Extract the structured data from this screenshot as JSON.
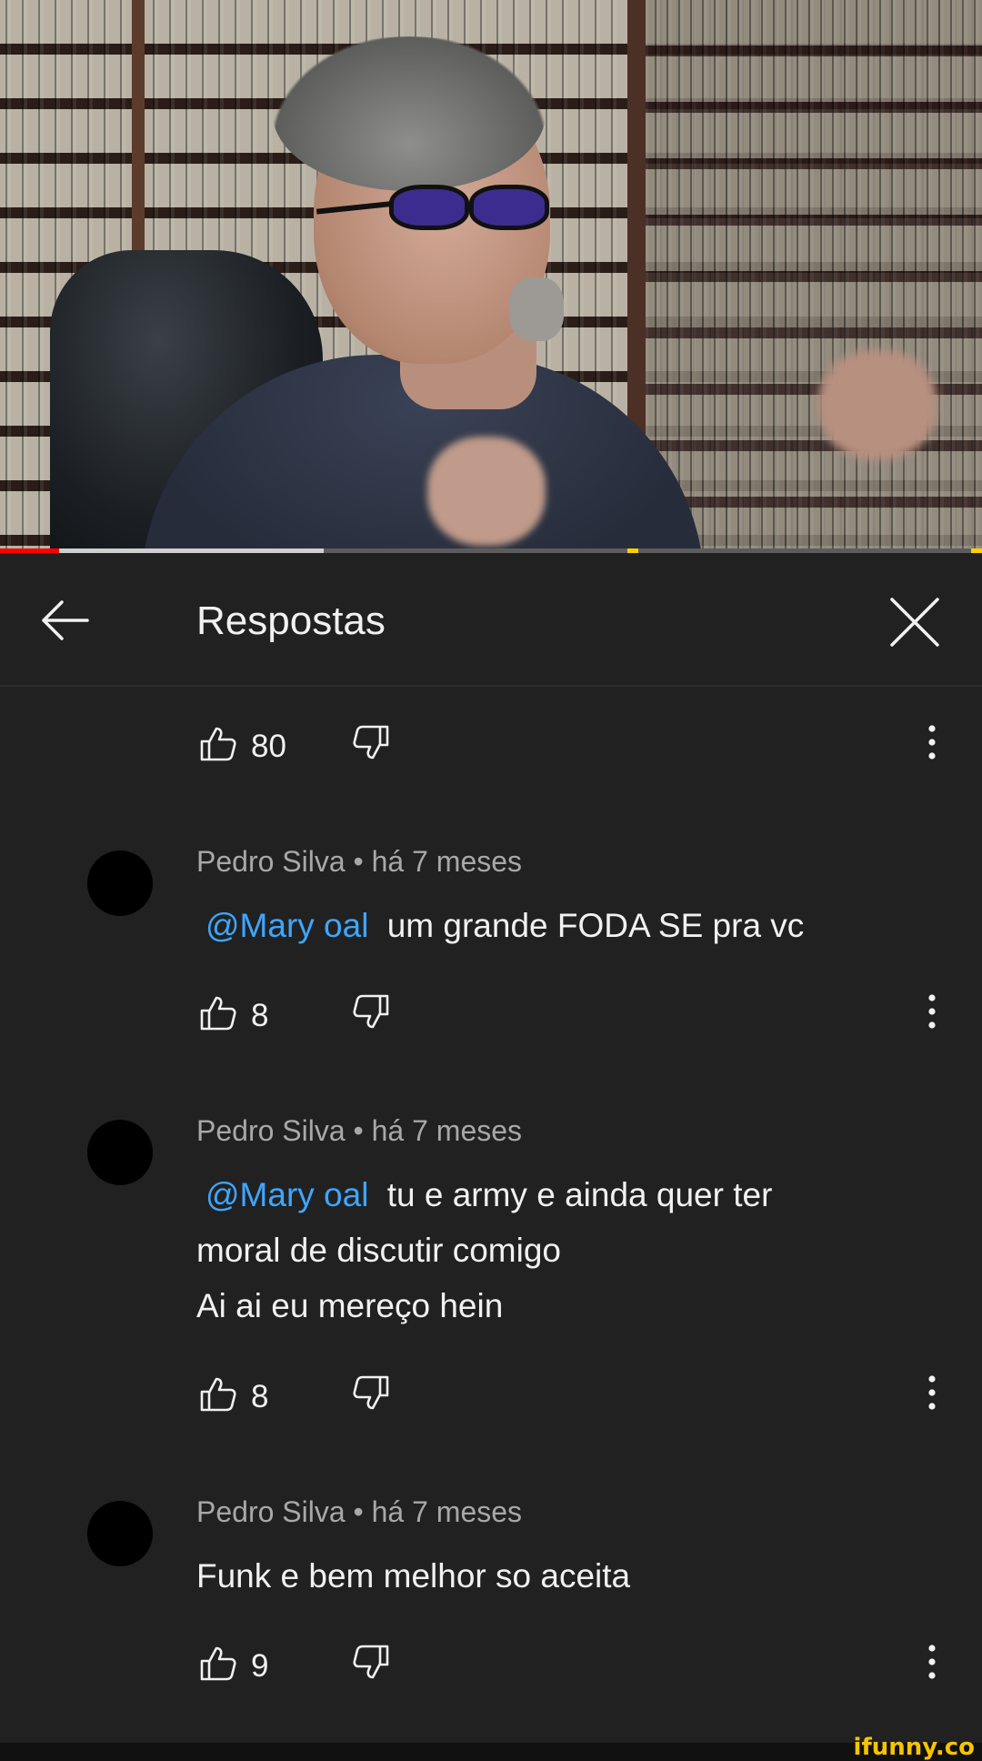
{
  "header": {
    "title": "Respostas"
  },
  "icons": {
    "back": "arrow-left-icon",
    "close": "close-icon",
    "like": "thumb-up-icon",
    "dislike": "thumb-down-icon",
    "more": "more-vert-icon"
  },
  "top_actions": {
    "likes": "80"
  },
  "comments": [
    {
      "author": "Pedro Silva",
      "time": "há 7 meses",
      "meta": "Pedro Silva • há 7 meses",
      "mention": "@Mary oal",
      "lines": [
        "um grande FODA SE pra vc"
      ],
      "likes": "8"
    },
    {
      "author": "Pedro Silva",
      "time": "há 7 meses",
      "meta": "Pedro Silva • há 7 meses",
      "mention": "@Mary oal",
      "lines": [
        "tu e army e ainda quer ter",
        "moral de discutir comigo",
        "Ai ai eu mereço hein"
      ],
      "likes": "8"
    },
    {
      "author": "Pedro Silva",
      "time": "há 7 meses",
      "meta": "Pedro Silva • há 7 meses",
      "mention": "",
      "lines": [
        "Funk e bem melhor so aceita"
      ],
      "likes": "9"
    }
  ],
  "video": {
    "progress_played": 0.06,
    "progress_buffered": 0.33
  },
  "colors": {
    "background": "#212121",
    "mention": "#3ea6ff",
    "progress": "#ff0000",
    "meta_text": "#a8a8a8"
  },
  "watermark": "ifunny.co"
}
